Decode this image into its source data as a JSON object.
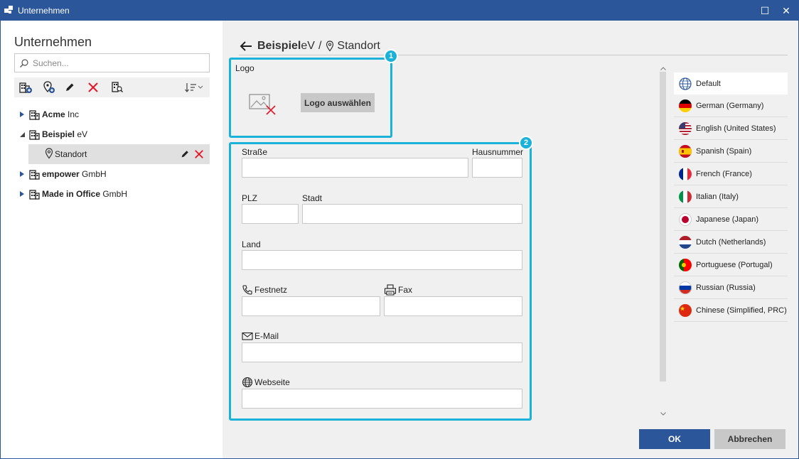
{
  "window": {
    "title": "Unternehmen",
    "maximize_glyph": "☐",
    "close_glyph": "✕"
  },
  "sidebar": {
    "heading": "Unternehmen",
    "search_placeholder": "Suchen...",
    "toolbar_icons": [
      "add-company-icon",
      "add-location-icon",
      "edit-icon",
      "delete-icon",
      "search-company-icon",
      "sort-icon"
    ],
    "tree": [
      {
        "bold": "Acme",
        "rest": " Inc",
        "expanded": false
      },
      {
        "bold": "Beispiel",
        "rest": " eV",
        "expanded": true
      },
      {
        "child": "Standort"
      },
      {
        "bold": "empower",
        "rest": " GmbH",
        "expanded": false
      },
      {
        "bold": "Made in Office",
        "rest": " GmbH",
        "expanded": false
      }
    ]
  },
  "breadcrumb": {
    "company_bold": "Beispiel",
    "company_rest": " eV",
    "separator": "/",
    "location": "Standort"
  },
  "callouts": {
    "one": "1",
    "two": "2"
  },
  "logo": {
    "label": "Logo",
    "button": "Logo auswählen"
  },
  "form": {
    "street": "Straße",
    "house_number": "Hausnummer",
    "zip": "PLZ",
    "city": "Stadt",
    "country": "Land",
    "phone": "Festnetz",
    "fax": "Fax",
    "email": "E-Mail",
    "website": "Webseite"
  },
  "languages": [
    {
      "label": "Default",
      "icon": "globe-icon"
    },
    {
      "label": "German (Germany)",
      "icon": "flag-de-icon"
    },
    {
      "label": "English (United States)",
      "icon": "flag-us-icon"
    },
    {
      "label": "Spanish (Spain)",
      "icon": "flag-es-icon"
    },
    {
      "label": "French (France)",
      "icon": "flag-fr-icon"
    },
    {
      "label": "Italian (Italy)",
      "icon": "flag-it-icon"
    },
    {
      "label": "Japanese (Japan)",
      "icon": "flag-jp-icon"
    },
    {
      "label": "Dutch (Netherlands)",
      "icon": "flag-nl-icon"
    },
    {
      "label": "Portuguese (Portugal)",
      "icon": "flag-pt-icon"
    },
    {
      "label": "Russian (Russia)",
      "icon": "flag-ru-icon"
    },
    {
      "label": "Chinese (Simplified, PRC)",
      "icon": "flag-cn-icon"
    }
  ],
  "buttons": {
    "ok": "OK",
    "cancel": "Abbrechen"
  },
  "colors": {
    "accent": "#2b579a",
    "callout": "#1ab2d8",
    "delete": "#e81123"
  }
}
